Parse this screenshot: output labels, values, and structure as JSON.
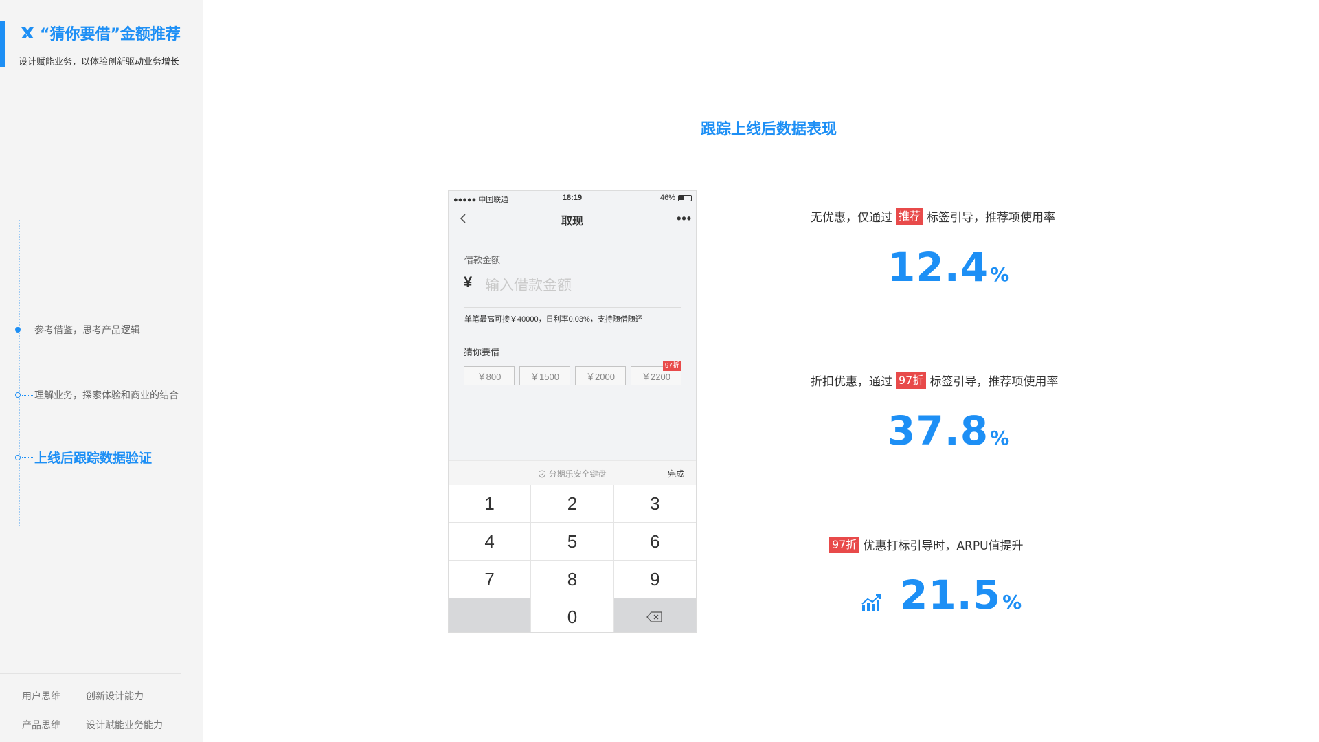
{
  "sidebar": {
    "title": "“猜你要借”金额推荐",
    "subtitle": "设计赋能业务，以体验创新驱动业务增长",
    "timeline": [
      {
        "label": "参考借鉴，思考产品逻辑",
        "active": false
      },
      {
        "label": "理解业务，探索体验和商业的结合",
        "active": false
      },
      {
        "label": "上线后跟踪数据验证",
        "active": true
      }
    ],
    "tags": [
      "用户思维",
      "创新设计能力",
      "产品思维",
      "设计赋能业务能力"
    ]
  },
  "main": {
    "title": "跟踪上线后数据表现"
  },
  "phone": {
    "status": {
      "carrier": "●●●●● 中国联通",
      "time": "18:19",
      "battery": "46%",
      "battery_level": 0.46
    },
    "nav_title": "取现",
    "field_label": "借款金额",
    "currency": "¥",
    "amount_placeholder": "输入借款金额",
    "hint": "单笔最高可接￥40000，日利率0.03%，支持随借随还",
    "guess_label": "猜你要借",
    "chips": [
      "￥800",
      "￥1500",
      "￥2000",
      "￥2200"
    ],
    "chip_badge": "97折",
    "keyboard_title": "分期乐安全键盘",
    "keyboard_done": "完成",
    "keys": [
      "1",
      "2",
      "3",
      "4",
      "5",
      "6",
      "7",
      "8",
      "9",
      "",
      "0"
    ]
  },
  "stats": [
    {
      "pre": "无优惠，仅通过",
      "tag": "推荐",
      "post": "标签引导，推荐项使用率",
      "value": "12.4",
      "unit": "%"
    },
    {
      "pre": "折扣优惠，通过",
      "tag": "97折",
      "post": "标签引导，推荐项使用率",
      "value": "37.8",
      "unit": "%"
    },
    {
      "pre": "",
      "tag": "97折",
      "post": "优惠打标引导时，ARPU值提升",
      "value": "21.5",
      "unit": "%"
    }
  ],
  "colors": {
    "accent": "#1d8ff5",
    "tag_red": "#e84a4a"
  },
  "icons": {
    "logo": "x-logo-icon",
    "growth": "growth-chart-icon",
    "back": "chevron-left-icon",
    "more": "more-dots-icon",
    "delete": "backspace-icon",
    "shield": "shield-icon"
  }
}
